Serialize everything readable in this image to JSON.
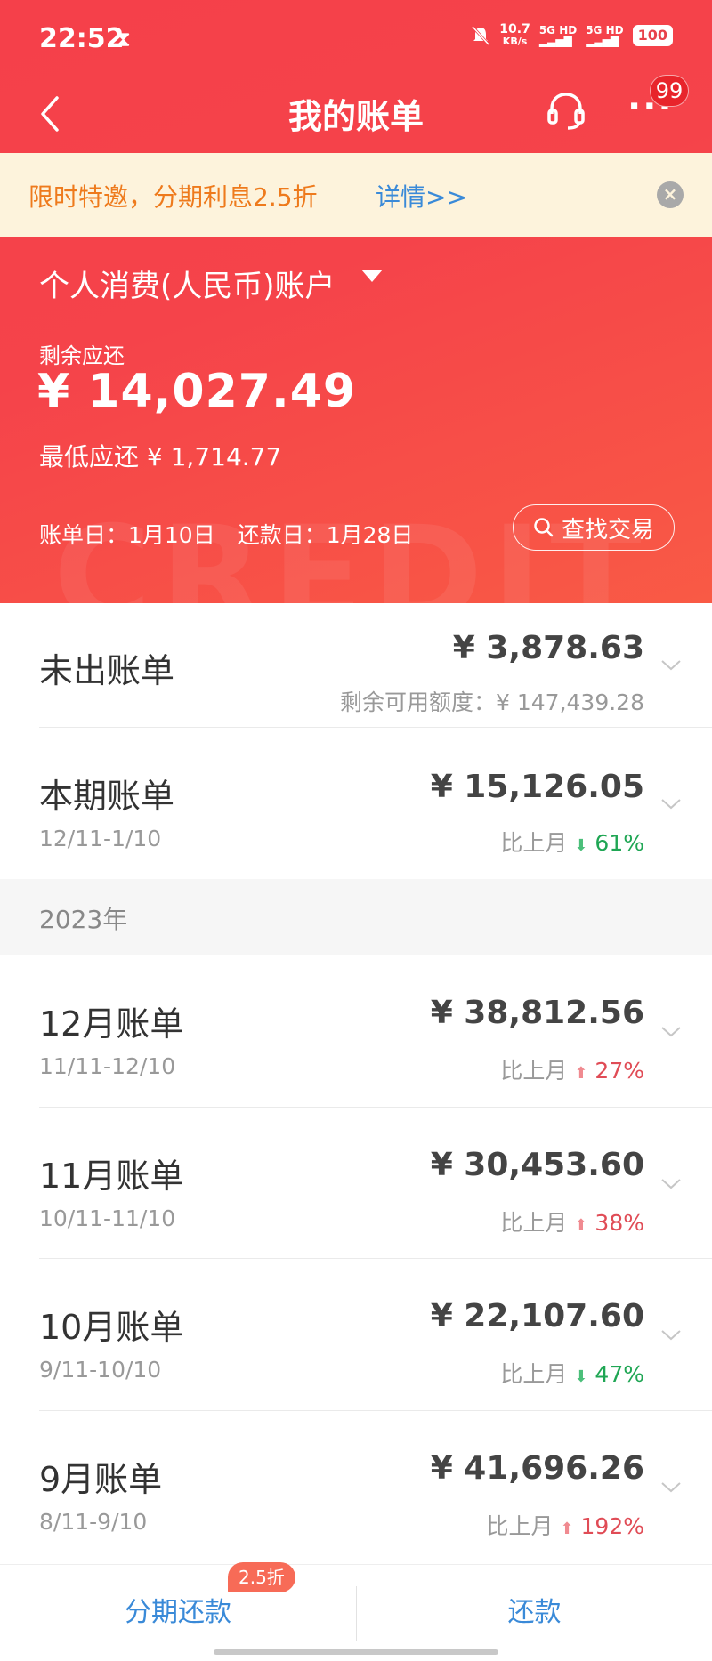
{
  "status_bar": {
    "time": "22:52",
    "net_speed_top": "10.7",
    "net_speed_bottom": "KB/s",
    "signal_1": "5G HD",
    "signal_2": "5G HD",
    "battery": "100"
  },
  "nav": {
    "title": "我的账单",
    "more_badge": "99"
  },
  "promo": {
    "text": "限时特邀，分期利息2.5折",
    "link": "详情>>"
  },
  "account": {
    "name": "个人消费(人民币)账户",
    "remaining_label": "剩余应还",
    "remaining_value": "¥ 14,027.49",
    "min_payment": "最低应还 ¥ 1,714.77",
    "dates": "账单日：1月10日　还款日：1月28日",
    "search_label": "查找交易"
  },
  "unbilled": {
    "title": "未出账单",
    "amount": "¥ 3,878.63",
    "credit_available": "剩余可用额度：¥ 147,439.28"
  },
  "current": {
    "title": "本期账单",
    "period": "12/11-1/10",
    "amount": "¥ 15,126.05",
    "compare_label": "比上月",
    "compare_pct": "61%",
    "trend": "down"
  },
  "year_header": "2023年",
  "bills": [
    {
      "title": "12月账单",
      "period": "11/11-12/10",
      "amount": "¥ 38,812.56",
      "compare_label": "比上月",
      "compare_pct": "27%",
      "trend": "up"
    },
    {
      "title": "11月账单",
      "period": "10/11-11/10",
      "amount": "¥ 30,453.60",
      "compare_label": "比上月",
      "compare_pct": "38%",
      "trend": "up"
    },
    {
      "title": "10月账单",
      "period": "9/11-10/10",
      "amount": "¥ 22,107.60",
      "compare_label": "比上月",
      "compare_pct": "47%",
      "trend": "down"
    },
    {
      "title": "9月账单",
      "period": "8/11-9/10",
      "amount": "¥ 41,696.26",
      "compare_label": "比上月",
      "compare_pct": "192%",
      "trend": "up"
    }
  ],
  "bottom": {
    "installment": "分期还款",
    "installment_badge": "2.5折",
    "repay": "还款"
  },
  "colors": {
    "header_red": "#f5404a",
    "promo_bg": "#fdf3dc",
    "promo_orange": "#ee7a1c",
    "link_blue": "#3a8ad8",
    "trend_up": "#e04c56",
    "trend_down": "#1fa654"
  }
}
